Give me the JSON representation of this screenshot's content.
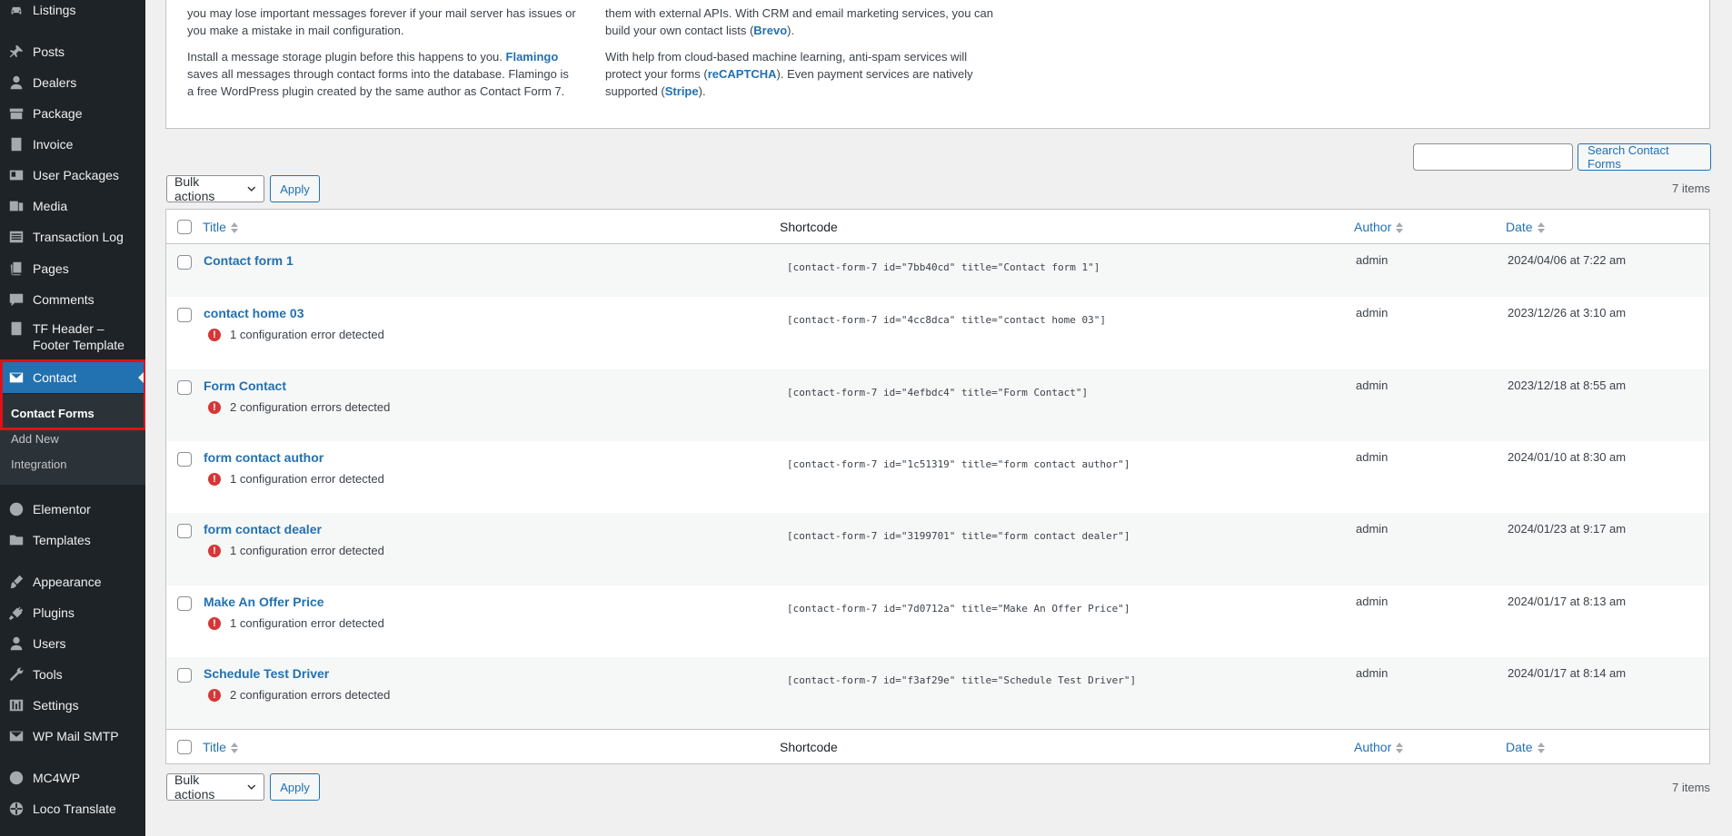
{
  "sidebar": {
    "items": [
      {
        "key": "listings",
        "label": "Listings",
        "icon": "car-icon"
      },
      {
        "key": "posts",
        "label": "Posts",
        "icon": "pin-icon"
      },
      {
        "key": "dealers",
        "label": "Dealers",
        "icon": "user-icon"
      },
      {
        "key": "package",
        "label": "Package",
        "icon": "archive-icon"
      },
      {
        "key": "invoice",
        "label": "Invoice",
        "icon": "document-icon"
      },
      {
        "key": "user-packages",
        "label": "User Packages",
        "icon": "id-card-icon"
      },
      {
        "key": "media",
        "label": "Media",
        "icon": "media-icon"
      },
      {
        "key": "transaction-log",
        "label": "Transaction Log",
        "icon": "list-icon"
      },
      {
        "key": "pages",
        "label": "Pages",
        "icon": "pages-icon"
      },
      {
        "key": "comments",
        "label": "Comments",
        "icon": "comment-icon"
      },
      {
        "key": "tf-header",
        "label": "TF Header – Footer Template",
        "icon": "document-icon"
      },
      {
        "key": "contact",
        "label": "Contact",
        "icon": "mail-icon"
      },
      {
        "key": "elementor",
        "label": "Elementor",
        "icon": "elementor-icon"
      },
      {
        "key": "templates",
        "label": "Templates",
        "icon": "folder-icon"
      },
      {
        "key": "appearance",
        "label": "Appearance",
        "icon": "brush-icon"
      },
      {
        "key": "plugins",
        "label": "Plugins",
        "icon": "plug-icon"
      },
      {
        "key": "users",
        "label": "Users",
        "icon": "user-icon"
      },
      {
        "key": "tools",
        "label": "Tools",
        "icon": "wrench-icon"
      },
      {
        "key": "settings",
        "label": "Settings",
        "icon": "sliders-icon"
      },
      {
        "key": "wp-mail-smtp",
        "label": "WP Mail SMTP",
        "icon": "mail-icon"
      },
      {
        "key": "mc4wp",
        "label": "MC4WP",
        "icon": "mc4wp-icon"
      },
      {
        "key": "loco-translate",
        "label": "Loco Translate",
        "icon": "globe-icon"
      }
    ],
    "submenu": [
      "Contact Forms",
      "Add New",
      "Integration"
    ]
  },
  "info": {
    "left": {
      "p1": "you may lose important messages forever if your mail server has issues or you make a mistake in mail configuration.",
      "p2_a": "Install a message storage plugin before this happens to you.",
      "p2_link": "Flamingo",
      "p2_b": "saves all messages through contact forms into the database. Flamingo is a free WordPress plugin created by the same author as Contact Form 7."
    },
    "right": {
      "p1_a": "them with external APIs. With CRM and email marketing services, you can build your own contact lists (",
      "p1_link": "Brevo",
      "p1_b": ").",
      "p2_a": "With help from cloud-based machine learning, anti-spam services will protect your forms (",
      "p2_link1": "reCAPTCHA",
      "p2_b": "). Even payment services are natively supported (",
      "p2_link2": "Stripe",
      "p2_c": ")."
    }
  },
  "controls": {
    "search_button": "Search Contact Forms",
    "bulk_actions": "Bulk actions",
    "apply": "Apply",
    "items_count": "7 items"
  },
  "table": {
    "headers": {
      "title": "Title",
      "shortcode": "Shortcode",
      "author": "Author",
      "date": "Date"
    },
    "rows": [
      {
        "title": "Contact form 1",
        "error": "",
        "shortcode": "[contact-form-7 id=\"7bb40cd\" title=\"Contact form 1\"]",
        "author": "admin",
        "date": "2024/04/06 at 7:22 am"
      },
      {
        "title": "contact home 03",
        "error": "1 configuration error detected",
        "shortcode": "[contact-form-7 id=\"4cc8dca\" title=\"contact home 03\"]",
        "author": "admin",
        "date": "2023/12/26 at 3:10 am"
      },
      {
        "title": "Form Contact",
        "error": "2 configuration errors detected",
        "shortcode": "[contact-form-7 id=\"4efbdc4\" title=\"Form Contact\"]",
        "author": "admin",
        "date": "2023/12/18 at 8:55 am"
      },
      {
        "title": "form contact author",
        "error": "1 configuration error detected",
        "shortcode": "[contact-form-7 id=\"1c51319\" title=\"form contact author\"]",
        "author": "admin",
        "date": "2024/01/10 at 8:30 am"
      },
      {
        "title": "form contact dealer",
        "error": "1 configuration error detected",
        "shortcode": "[contact-form-7 id=\"3199701\" title=\"form contact dealer\"]",
        "author": "admin",
        "date": "2024/01/23 at 9:17 am"
      },
      {
        "title": "Make An Offer Price",
        "error": "1 configuration error detected",
        "shortcode": "[contact-form-7 id=\"7d0712a\" title=\"Make An Offer Price\"]",
        "author": "admin",
        "date": "2024/01/17 at 8:13 am"
      },
      {
        "title": "Schedule Test Driver",
        "error": "2 configuration errors detected",
        "shortcode": "[contact-form-7 id=\"f3af29e\" title=\"Schedule Test Driver\"]",
        "author": "admin",
        "date": "2024/01/17 at 8:14 am"
      }
    ]
  },
  "colors": {
    "accent": "#2271b1",
    "sidebar_bg": "#1d2327",
    "error": "#d63638",
    "highlight_border": "#e30f17"
  }
}
